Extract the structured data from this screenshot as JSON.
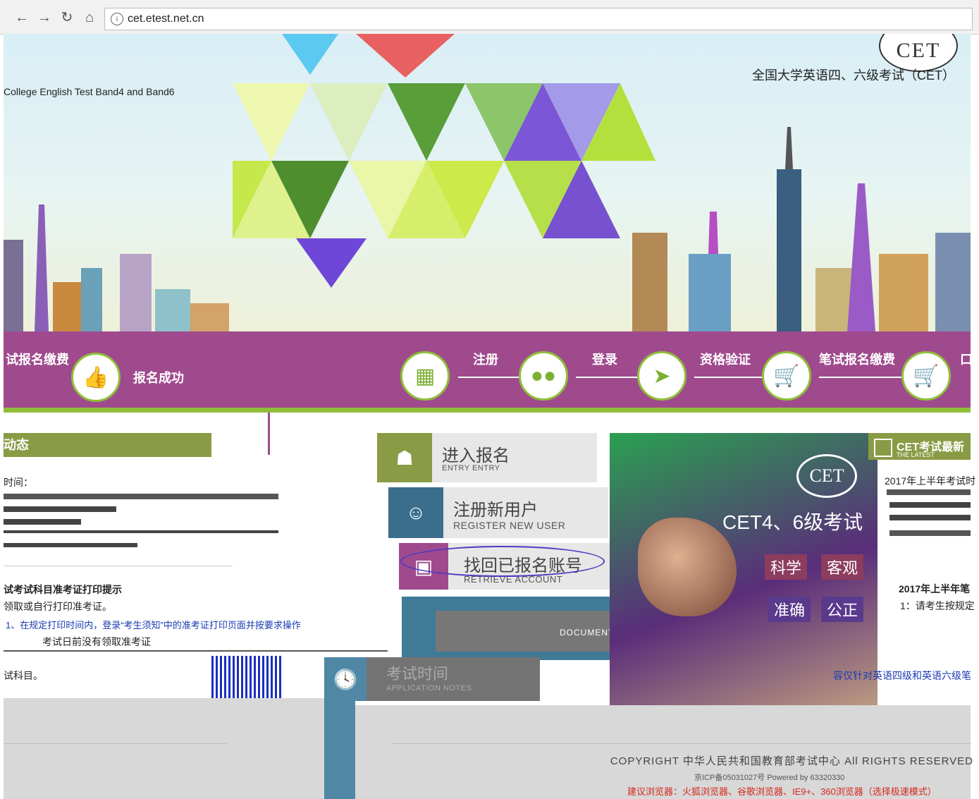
{
  "browser": {
    "url": "cet.etest.net.cn",
    "back_icon": "back-arrow-icon",
    "forward_icon": "forward-arrow-icon",
    "reload_icon": "reload-icon",
    "home_icon": "home-icon",
    "info_glyph": "i"
  },
  "banner": {
    "logo_text": "CET",
    "site_title": "全国大学英语四、六级考试（CET）",
    "subtitle": "College English Test Band4 and Band6"
  },
  "steps": {
    "left_label": "试报名缴费",
    "success_label": "报名成功",
    "items": [
      {
        "label": "注册",
        "icon": "id-card-icon"
      },
      {
        "label": "登录",
        "icon": "users-icon"
      },
      {
        "label": "资格验证",
        "icon": "verify-icon"
      },
      {
        "label": "笔试报名缴费",
        "icon": "cart-icon"
      },
      {
        "label": "口",
        "icon": "cart-plus-icon"
      }
    ]
  },
  "news": {
    "tab_label": "动态",
    "time_label": "时间：",
    "article_title": "试考试科目准考证打印提示",
    "article_line1": "领取或自行打印准考证。",
    "article_line2": "考试日前没有领取准考证",
    "article_line3": "1、在规定打印时间内，登录“考生须知”中的准考证打印页面并按要求操作",
    "article_line4": "试科目。"
  },
  "actions": {
    "enter": {
      "cn": "进入报名",
      "en": "ENTRY ENTRY"
    },
    "register": {
      "cn": "注册新用户",
      "en": "REGISTER NEW USER"
    },
    "retrieve": {
      "cn": "找回已报名账号",
      "en": "RETRIEVE ACCOUNT"
    },
    "schedule": {
      "cn": "考试时间",
      "en": "APPLICATION NOTES"
    },
    "notes_link": "DOCUMENTS & SERVICES"
  },
  "promo": {
    "seal": "CET",
    "headline": "CET4、6级考试",
    "tags": [
      "科学",
      "客观",
      "准确",
      "公正"
    ]
  },
  "latest": {
    "tab_cn": "CET考试最新",
    "tab_en": "THE LATEST",
    "item1": "2017年上半年考试时",
    "item2": "2017年上半年笔",
    "item3": "1：请考生按规定",
    "notice": "容仅针对英语四级和英语六级笔"
  },
  "footer": {
    "copyright": "COPYRIGHT 中华人民共和国教育部考试中心 All RIGHTS RESERVED",
    "icp": "京ICP备05031027号 Powered by 63320330",
    "browsers": "建议浏览器：火狐浏览器、谷歌浏览器、IE9+、360浏览器（选择极速模式）"
  }
}
